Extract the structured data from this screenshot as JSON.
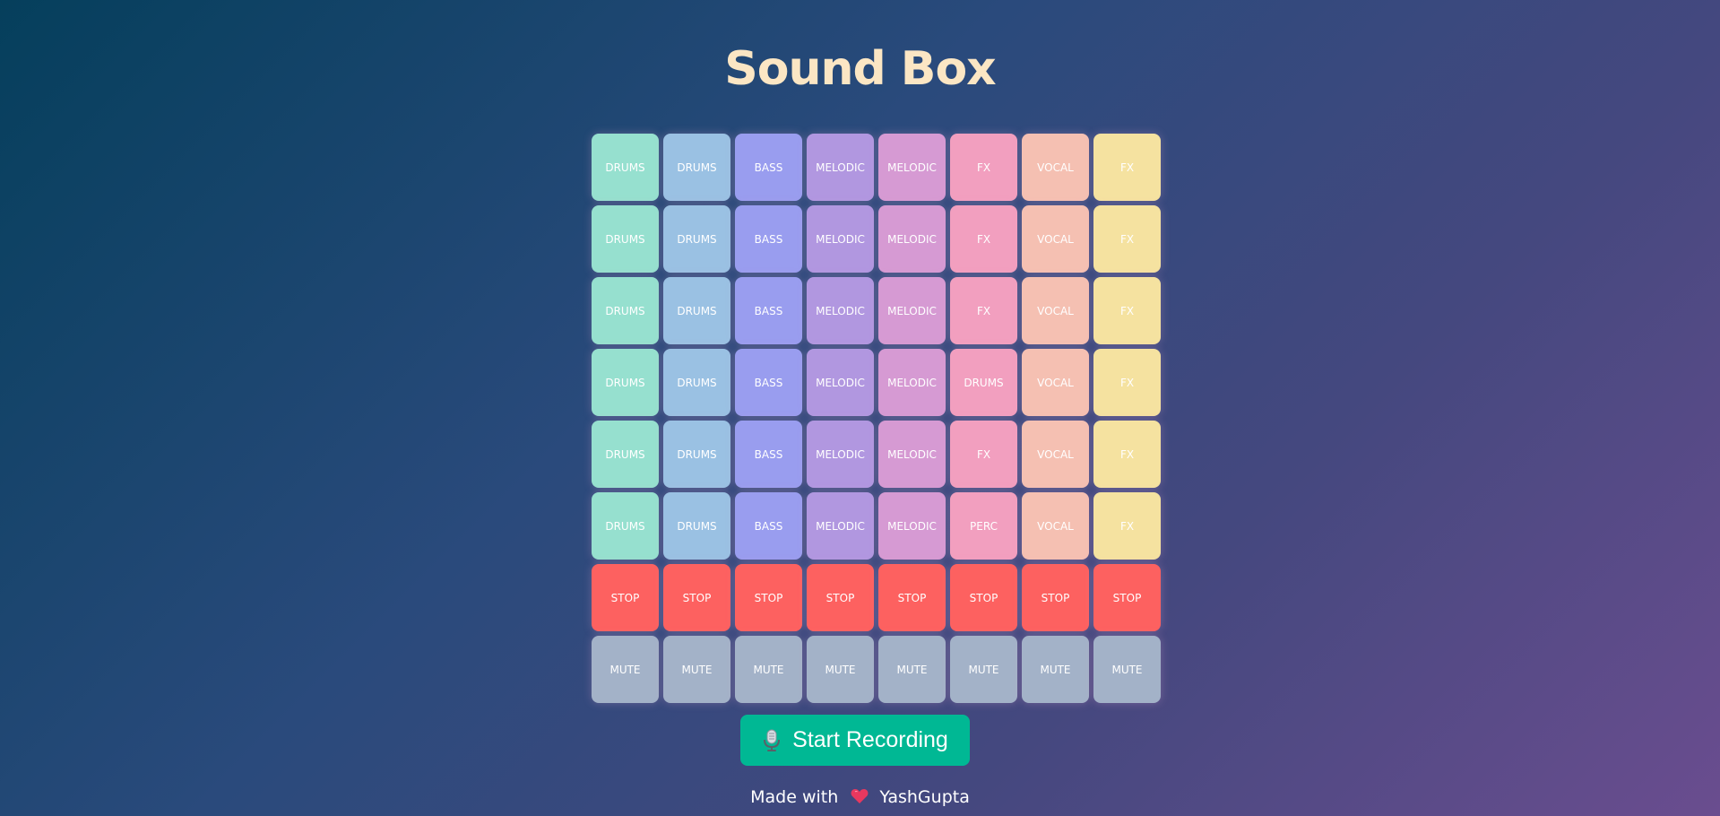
{
  "app": {
    "title": "Sound Box"
  },
  "pad_colors": {
    "DRUMS-col0": "#96e0cf",
    "DRUMS-col1": "#9ac1e3",
    "BASS": "#999def",
    "MELODIC-col3": "#b197e0",
    "MELODIC-col4": "#d69ad3",
    "pink": "#f29fbf",
    "VOCAL": "#f5c0b2",
    "yellow": "#f5e2a0",
    "STOP": "#fd6160",
    "MUTE": "#a3b2c8"
  },
  "grid": {
    "rows": [
      [
        "DRUMS",
        "DRUMS",
        "BASS",
        "MELODIC",
        "MELODIC",
        "FX",
        "VOCAL",
        "FX"
      ],
      [
        "DRUMS",
        "DRUMS",
        "BASS",
        "MELODIC",
        "MELODIC",
        "FX",
        "VOCAL",
        "FX"
      ],
      [
        "DRUMS",
        "DRUMS",
        "BASS",
        "MELODIC",
        "MELODIC",
        "FX",
        "VOCAL",
        "FX"
      ],
      [
        "DRUMS",
        "DRUMS",
        "BASS",
        "MELODIC",
        "MELODIC",
        "DRUMS",
        "VOCAL",
        "FX"
      ],
      [
        "DRUMS",
        "DRUMS",
        "BASS",
        "MELODIC",
        "MELODIC",
        "FX",
        "VOCAL",
        "FX"
      ],
      [
        "DRUMS",
        "DRUMS",
        "BASS",
        "MELODIC",
        "MELODIC",
        "PERC",
        "VOCAL",
        "FX"
      ],
      [
        "STOP",
        "STOP",
        "STOP",
        "STOP",
        "STOP",
        "STOP",
        "STOP",
        "STOP"
      ],
      [
        "MUTE",
        "MUTE",
        "MUTE",
        "MUTE",
        "MUTE",
        "MUTE",
        "MUTE",
        "MUTE"
      ]
    ]
  },
  "record": {
    "label": "Start Recording",
    "icon": "microphone-icon",
    "color": "#00b894"
  },
  "footer": {
    "prefix": "Made with",
    "icon": "heart-icon",
    "author": "YashGupta"
  }
}
